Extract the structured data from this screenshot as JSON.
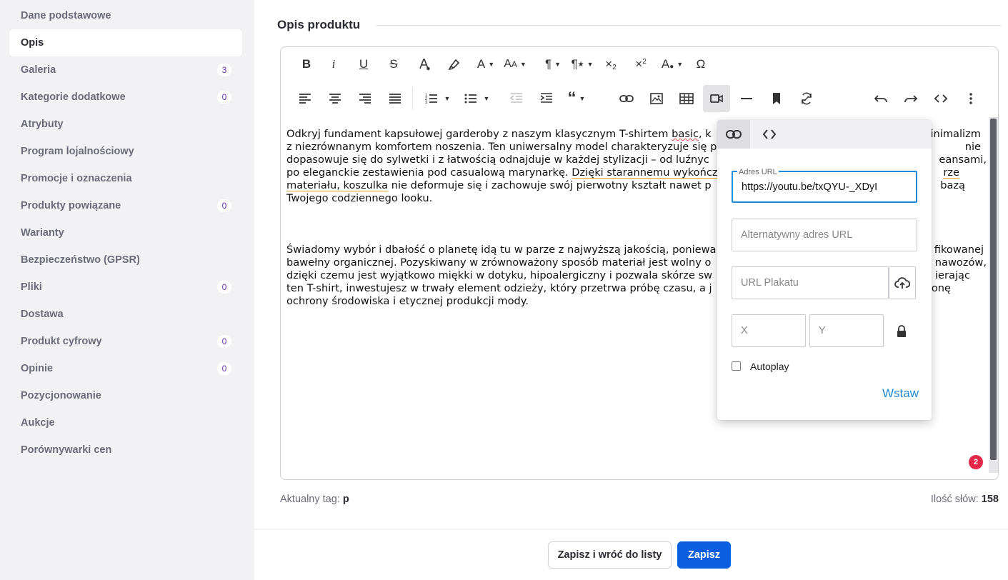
{
  "sidebar": {
    "items": [
      {
        "label": "Dane podstawowe",
        "badge": ""
      },
      {
        "label": "Opis",
        "badge": "",
        "active": true
      },
      {
        "label": "Galeria",
        "badge": "3"
      },
      {
        "label": "Kategorie dodatkowe",
        "badge": "0"
      },
      {
        "label": "Atrybuty",
        "badge": ""
      },
      {
        "label": "Program lojalnościowy",
        "badge": ""
      },
      {
        "label": "Promocje i oznaczenia",
        "badge": ""
      },
      {
        "label": "Produkty powiązane",
        "badge": "0"
      },
      {
        "label": "Warianty",
        "badge": ""
      },
      {
        "label": "Bezpieczeństwo (GPSR)",
        "badge": ""
      },
      {
        "label": "Pliki",
        "badge": "0"
      },
      {
        "label": "Dostawa",
        "badge": ""
      },
      {
        "label": "Produkt cyfrowy",
        "badge": "0"
      },
      {
        "label": "Opinie",
        "badge": "0"
      },
      {
        "label": "Pozycjonowanie",
        "badge": ""
      },
      {
        "label": "Aukcje",
        "badge": ""
      },
      {
        "label": "Porównywarki cen",
        "badge": ""
      }
    ]
  },
  "main": {
    "section_title": "Opis produktu"
  },
  "toolbar": {
    "row1": [
      "bold-icon",
      "italic-icon",
      "underline-icon",
      "strikethrough-icon",
      "font-color-icon",
      "highlighter-icon",
      "font-family-icon",
      "font-size-icon",
      "paragraph-format-icon",
      "paragraph-style-icon",
      "subscript-icon",
      "superscript-icon",
      "text-style-icon",
      "special-characters-icon"
    ],
    "row2": [
      "align-left-icon",
      "align-center-icon",
      "align-right-icon",
      "align-justify-icon",
      "ordered-list-icon",
      "unordered-list-icon",
      "outdent-icon",
      "indent-icon",
      "quote-icon",
      "insert-link-icon",
      "insert-image-icon",
      "insert-table-icon",
      "insert-video-icon",
      "horizontal-line-icon",
      "bookmark-icon",
      "clear-format-icon",
      "undo-icon",
      "redo-icon",
      "code-view-icon",
      "more-icon"
    ]
  },
  "content": {
    "p1_a": "Odkryj fundament kapsułowej garderoby z naszym klasycznym T-shirtem ",
    "p1_spell": "basic",
    "p1_b": ", k",
    "p1_right1": "inimalizm",
    "p1_line2": "z niezrównanym komfortem noszenia. Ten uniwersalny model charakteryzuje się p",
    "p1_right2": "nie",
    "p1_line3": "dopasowuje się do sylwetki i z łatwością odnajduje w każdej stylizacji – od luźnyc",
    "p1_right3": "eansami,",
    "p1_line4a": "po eleganckie zestawienia pod casualową marynarkę. ",
    "p1_line4b": "Dzięki starannemu wykończ",
    "p1_right4": "rze",
    "p1_line5a": "materiału, koszulka",
    "p1_line5b": " nie deformuje się i zachowuje swój pierwotny kształt nawet p",
    "p1_right5": "bazą",
    "p1_line6": "Twojego codziennego looku.",
    "p2_line1": "Świadomy wybór i dbałość o planetę idą tu w parze z najwyższą jakością, poniewa",
    "p2_right1": "fikowanej",
    "p2_line2": "bawełny organicznej. Pozyskiwany w zrównoważony sposób materiał jest wolny o",
    "p2_right2": "nawozów,",
    "p2_line3": "dzięki czemu jest wyjątkowo miękki w dotyku, hipoalergiczny i pozwala skórze sw",
    "p2_right3": "ierając",
    "p2_line4": "ten T-shirt, inwestujesz w trwały element odzieży, który przetrwa próbę czasu, a j",
    "p2_right4": "ronę",
    "p2_line5": "ochrony środowiska i etycznej produkcji mody."
  },
  "status": {
    "tag_label": "Aktualny tag:",
    "tag_value": "p",
    "words_label": "Ilość słów:",
    "words_value": "158",
    "notification_count": "2"
  },
  "video_popup": {
    "url_label": "Adres URL",
    "url_value": "https://youtu.be/txQYU-_XDyI",
    "alt_url_placeholder": "Alternatywny adres URL",
    "poster_placeholder": "URL Plakatu",
    "x_placeholder": "X",
    "y_placeholder": "Y",
    "autoplay_label": "Autoplay",
    "insert_label": "Wstaw"
  },
  "footer": {
    "save_back_label": "Zapisz i wróć do listy",
    "save_label": "Zapisz"
  },
  "colors": {
    "primary": "#0a5fe0",
    "link": "#1e8ad6",
    "badge_text": "#6b2fb3",
    "alert": "#e5284a"
  }
}
